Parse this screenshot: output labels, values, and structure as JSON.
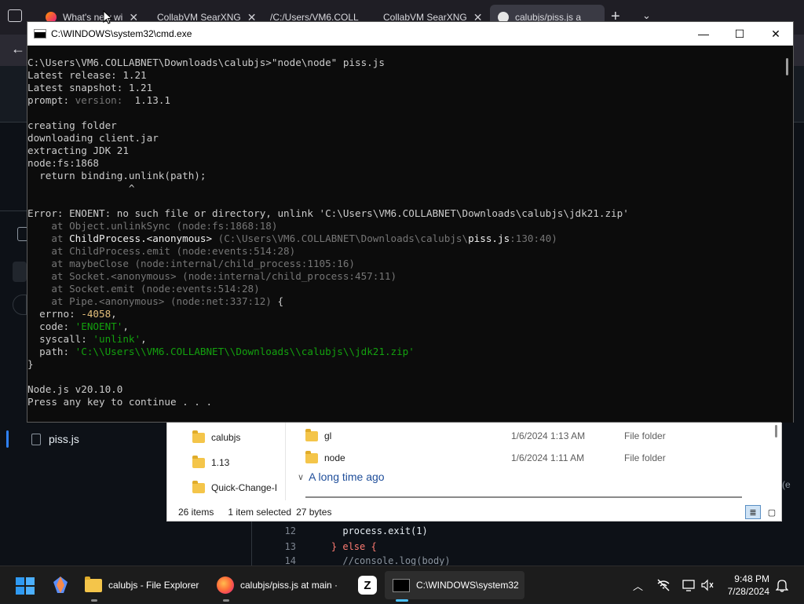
{
  "browser": {
    "tabs": [
      {
        "label": "What's new wi",
        "active": false
      },
      {
        "label": "CollabVM SearXNG",
        "active": false
      },
      {
        "label": "/C:/Users/VM6.COLL",
        "active": false
      },
      {
        "label": "CollabVM SearXNG",
        "active": false
      },
      {
        "label": "calubjs/piss.js a",
        "active": true
      }
    ],
    "new_tab": "+",
    "tab_close": "✕",
    "sidebar_file": "piss.js",
    "code_lines": [
      {
        "num": "12",
        "text": "      process.exit(1)"
      },
      {
        "num": "13",
        "text": "    } else {"
      },
      {
        "num": "14",
        "text": "      //console.log(body)"
      }
    ]
  },
  "explorer": {
    "nav_items": [
      "calubjs",
      "1.13",
      "Quick-Change-I"
    ],
    "rows": [
      {
        "name": "gl",
        "date": "1/6/2024 1:13 AM",
        "type": "File folder"
      },
      {
        "name": "node",
        "date": "1/6/2024 1:11 AM",
        "type": "File folder"
      }
    ],
    "group_header": "A long time ago",
    "status": {
      "items": "26 items",
      "selected": "1 item selected",
      "size": "27 bytes"
    }
  },
  "cmd": {
    "title": "C:\\WINDOWS\\system32\\cmd.exe",
    "minimize": "—",
    "maximize": "☐",
    "close": "✕",
    "lines": {
      "l1": "C:\\Users\\VM6.COLLABNET\\Downloads\\calubjs>\"node\\node\" piss.js",
      "l2": "Latest release: 1.21",
      "l3": "Latest snapshot: 1.21",
      "l4_a": "prompt: ",
      "l4_b": "version: ",
      "l4_c": " 1.13.1",
      "l6": "creating folder",
      "l7": "downloading client.jar",
      "l8": "extracting JDK 21",
      "l9": "node:fs:1868",
      "l10": "  return binding.unlink(path);",
      "l11": "                 ^",
      "l13": "Error: ENOENT: no such file or directory, unlink 'C:\\Users\\VM6.COLLABNET\\Downloads\\calubjs\\jdk21.zip'",
      "l14": "    at Object.unlinkSync (node:fs:1868:18)",
      "l15_a": "    at ",
      "l15_b": "ChildProcess.<anonymous>",
      "l15_c": " (C:\\Users\\VM6.COLLABNET\\Downloads\\calubjs\\",
      "l15_d": "piss.js",
      "l15_e": ":130:40)",
      "l16": "    at ChildProcess.emit (node:events:514:28)",
      "l17": "    at maybeClose (node:internal/child_process:1105:16)",
      "l18": "    at Socket.<anonymous> (node:internal/child_process:457:11)",
      "l19": "    at Socket.emit (node:events:514:28)",
      "l20_a": "    at Pipe.<anonymous> (node:net:337:12)",
      "l20_b": " {",
      "l21_a": "  errno: ",
      "l21_b": "-4058",
      "l21_c": ",",
      "l22_a": "  code: ",
      "l22_b": "'ENOENT'",
      "l22_c": ",",
      "l23_a": "  syscall: ",
      "l23_b": "'unlink'",
      "l23_c": ",",
      "l24_a": "  path: ",
      "l24_b": "'C:\\\\Users\\\\VM6.COLLABNET\\\\Downloads\\\\calubjs\\\\jdk21.zip'",
      "l25": "}",
      "l27": "Node.js v20.10.0",
      "l28": "Press any key to continue . . ."
    }
  },
  "taskbar": {
    "apps": [
      {
        "label": "calubjs - File Explorer"
      },
      {
        "label": "calubjs/piss.js at main ·"
      },
      {
        "label": "C:\\WINDOWS\\system32"
      }
    ],
    "clock_time": "9:48 PM",
    "clock_date": "7/28/2024"
  }
}
